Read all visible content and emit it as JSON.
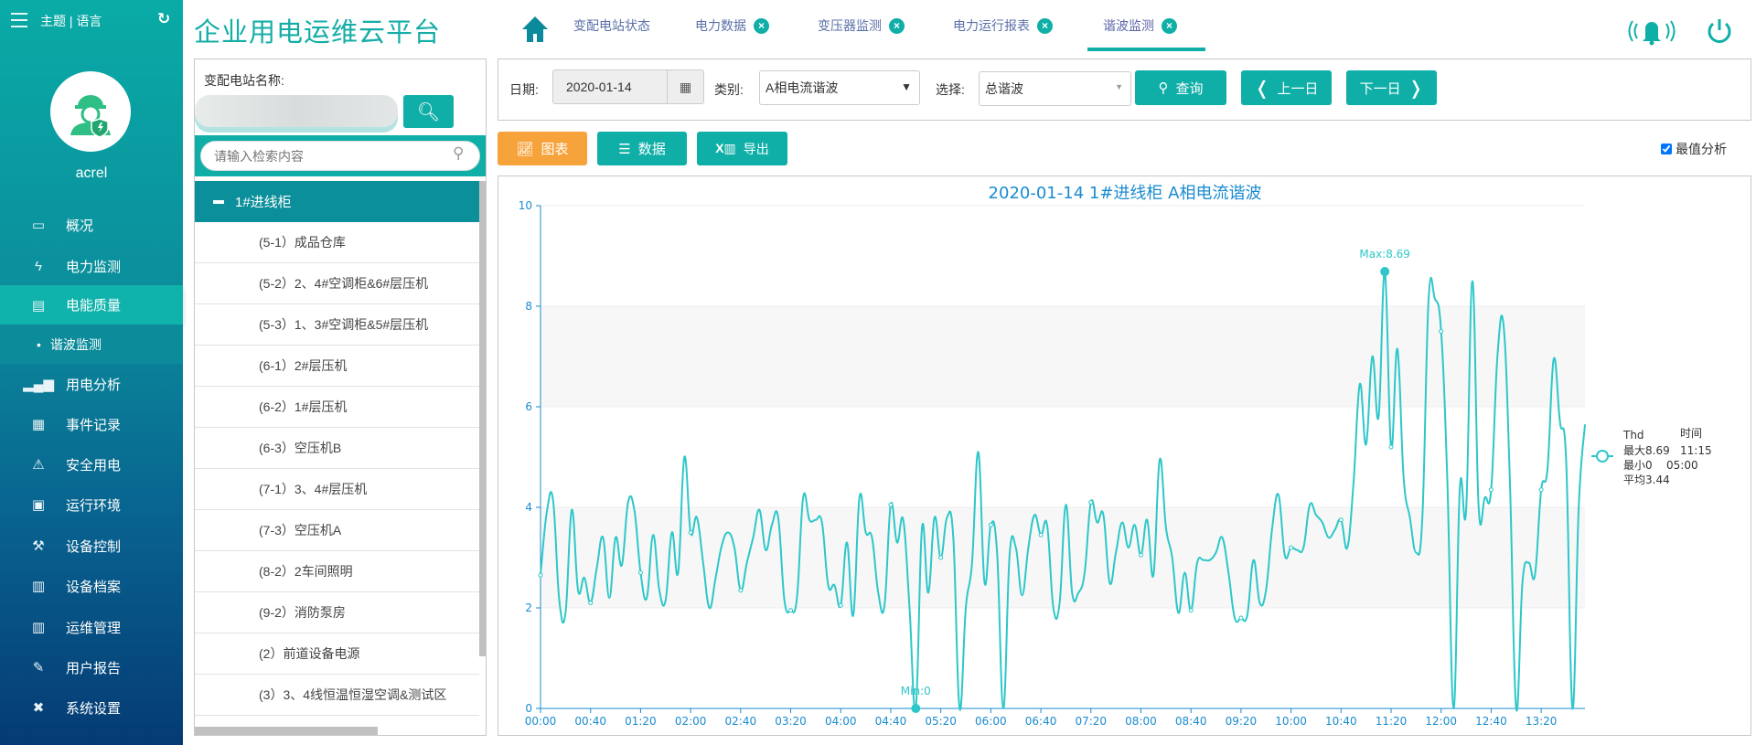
{
  "sidebar": {
    "theme_lang": "主题 | 语言",
    "username": "acrel",
    "items": [
      {
        "label": "概况",
        "icon": "monitor-icon"
      },
      {
        "label": "电力监测",
        "icon": "lightning-icon"
      },
      {
        "label": "电能质量",
        "icon": "chart-area-icon"
      },
      {
        "label": "谐波监测",
        "icon": "dot-icon"
      },
      {
        "label": "用电分析",
        "icon": "bar-chart-icon"
      },
      {
        "label": "事件记录",
        "icon": "document-icon"
      },
      {
        "label": "安全用电",
        "icon": "alarm-light-icon"
      },
      {
        "label": "运行环境",
        "icon": "camera-icon"
      },
      {
        "label": "设备控制",
        "icon": "wrench-icon"
      },
      {
        "label": "设备档案",
        "icon": "archive-icon"
      },
      {
        "label": "运维管理",
        "icon": "cabinet-icon"
      },
      {
        "label": "用户报告",
        "icon": "edit-icon"
      },
      {
        "label": "系统设置",
        "icon": "tools-icon"
      }
    ]
  },
  "header": {
    "title": "企业用电运维云平台",
    "tabs": [
      {
        "label": "变配电站状态"
      },
      {
        "label": "电力数据"
      },
      {
        "label": "变压器监测"
      },
      {
        "label": "电力运行报表"
      },
      {
        "label": "谐波监测"
      }
    ],
    "close_glyph": "×"
  },
  "left_panel": {
    "station_label": "变配电站名称:",
    "search_placeholder": "请输入检索内容",
    "tree_root": "1#进线柜",
    "tree_items": [
      "(5-1）成品仓库",
      "(5-2）2、4#空调柜&6#层压机",
      "(5-3）1、3#空调柜&5#层压机",
      "(6-1）2#层压机",
      "(6-2）1#层压机",
      "(6-3）空压机B",
      "(7-1）3、4#层压机",
      "(7-3）空压机A",
      "(8-2）2车间照明",
      "(9-2）消防泵房",
      "(2）前道设备电源",
      "(3）3、4线恒温恒湿空调&测试区"
    ]
  },
  "filters": {
    "date_label": "日期:",
    "date_value": "2020-01-14",
    "category_label": "类别:",
    "category_value": "A相电流谐波",
    "select_label": "选择:",
    "select_value": "总谐波",
    "query": "查询",
    "prev_day": "上一日",
    "next_day": "下一日"
  },
  "toolbar": {
    "chart": "图表",
    "data": "数据",
    "export": "导出",
    "extreme_analysis": "最值分析",
    "extreme_checked": true
  },
  "colors": {
    "accent": "#0fafa8",
    "orange": "#f7a33c",
    "line": "#2ec7c9",
    "axis": "#1a8bd0"
  },
  "chart_data": {
    "type": "line",
    "title": "2020-01-14  1#进线柜  A相电流谐波",
    "ylim": [
      0,
      10
    ],
    "yticks": [
      0,
      2,
      4,
      6,
      8,
      10
    ],
    "xticks": [
      "00:00",
      "00:40",
      "01:20",
      "02:00",
      "02:40",
      "03:20",
      "04:00",
      "04:40",
      "05:20",
      "06:00",
      "06:40",
      "07:20",
      "08:00",
      "08:40",
      "09:20",
      "10:00",
      "10:40",
      "11:20",
      "12:00",
      "12:40",
      "13:20"
    ],
    "x_interval_min": 5,
    "x_start": "00:00",
    "series": [
      {
        "name": "Thd",
        "values": [
          2.65,
          3.9,
          4.15,
          2.15,
          1.9,
          3.95,
          2.35,
          2.6,
          2.1,
          2.8,
          3.4,
          2.2,
          3.4,
          2.85,
          4.1,
          3.95,
          2.7,
          2.2,
          3.45,
          2.35,
          2.15,
          3.5,
          2.7,
          5.0,
          3.5,
          3.8,
          2.9,
          2.0,
          2.6,
          3.25,
          3.5,
          3.2,
          2.35,
          2.9,
          3.4,
          3.95,
          3.15,
          3.65,
          3.8,
          2.15,
          1.95,
          2.2,
          4.2,
          3.75,
          3.75,
          3.7,
          2.45,
          2.45,
          2.05,
          3.3,
          1.85,
          4.2,
          3.5,
          3.4,
          2.3,
          2.05,
          4.05,
          3.3,
          3.75,
          2.0,
          0,
          3.6,
          2.3,
          3.8,
          3.0,
          3.8,
          3.4,
          0,
          2.0,
          2.9,
          5.1,
          2.5,
          3.65,
          3.1,
          0,
          3.05,
          3.2,
          2.25,
          3.2,
          3.85,
          3.45,
          3.65,
          2.0,
          2.1,
          4.05,
          2.3,
          2.3,
          2.7,
          4.1,
          3.7,
          3.85,
          2.5,
          3.1,
          3.7,
          3.2,
          3.65,
          3.05,
          3.75,
          2.65,
          4.95,
          3.6,
          3.0,
          1.9,
          2.7,
          1.95,
          2.9,
          2.95,
          2.95,
          3.1,
          3.4,
          2.7,
          1.8,
          1.8,
          1.85,
          2.95,
          2.1,
          2.35,
          3.6,
          4.25,
          3.05,
          3.2,
          3.15,
          3.2,
          4.05,
          3.85,
          3.7,
          3.4,
          3.55,
          3.75,
          3.2,
          4.5,
          6.45,
          5.25,
          7.0,
          5.8,
          8.69,
          5.2,
          7.15,
          4.6,
          3.8,
          3.1,
          3.8,
          8.15,
          8.15,
          7.5,
          4.5,
          0,
          4.4,
          3.95,
          8.5,
          4.0,
          4.2,
          4.35,
          7.0,
          7.6,
          4.5,
          0,
          2.5,
          2.9,
          2.65,
          4.35,
          4.75,
          6.95,
          5.7,
          4.9,
          0,
          4.0,
          5.65
        ]
      }
    ],
    "max_label": "Max:8.69",
    "min_label": "Min:0",
    "legend": {
      "name": "Thd",
      "time_header": "时间",
      "max": "最大8.69",
      "max_time": "11:15",
      "min": "最小0",
      "min_time": "05:00",
      "avg": "平均3.44",
      "placement": "right"
    }
  }
}
